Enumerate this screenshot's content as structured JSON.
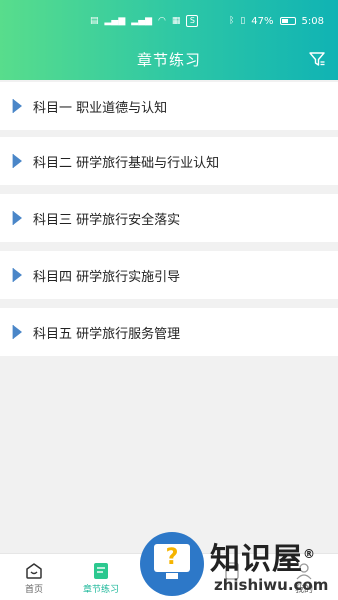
{
  "status_bar": {
    "left_icons": [
      "sim-card-icon",
      "signal-icon",
      "signal-icon",
      "wifi-icon",
      "qr-icon",
      "app-icon"
    ],
    "battery_percent": "47%",
    "time": "5:08"
  },
  "header": {
    "title": "章节练习",
    "filter_icon": "filter-icon"
  },
  "chapters": [
    {
      "label": "科目一  职业道德与认知"
    },
    {
      "label": "科目二  研学旅行基础与行业认知"
    },
    {
      "label": "科目三  研学旅行安全落实"
    },
    {
      "label": "科目四  研学旅行实施引导"
    },
    {
      "label": "科目五  研学旅行服务管理"
    }
  ],
  "tabs": [
    {
      "label": "首页",
      "icon": "home-icon",
      "active": false
    },
    {
      "label": "章节练习",
      "icon": "book-icon",
      "active": true
    },
    {
      "label": "",
      "icon": "doc-icon",
      "active": false
    },
    {
      "label": "我的",
      "icon": "user-icon",
      "active": false
    }
  ],
  "watermark": {
    "text": "知识屋",
    "url": "zhishiwu.com",
    "mark": "®",
    "question": "?"
  },
  "colors": {
    "header_start": "#58dd8c",
    "header_end": "#10b3b4",
    "accent": "#1fb89b",
    "triangle": "#4a86c8"
  }
}
